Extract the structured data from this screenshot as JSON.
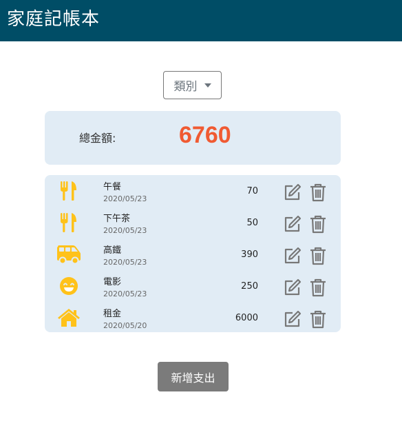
{
  "app": {
    "title": "家庭記帳本"
  },
  "filter": {
    "category_label": "類別"
  },
  "summary": {
    "total_label": "總金額:",
    "total_value": "6760"
  },
  "colors": {
    "header": "#004d66",
    "accent_icon": "#ffc21a",
    "total": "#f05a32",
    "card": "#e1ecf5"
  },
  "expenses": [
    {
      "icon": "utensils-icon",
      "name": "午餐",
      "date": "2020/05/23",
      "amount": "70"
    },
    {
      "icon": "utensils-icon",
      "name": "下午茶",
      "date": "2020/05/23",
      "amount": "50"
    },
    {
      "icon": "shuttle-van-icon",
      "name": "高鐵",
      "date": "2020/05/23",
      "amount": "390"
    },
    {
      "icon": "grin-icon",
      "name": "電影",
      "date": "2020/05/23",
      "amount": "250"
    },
    {
      "icon": "home-icon",
      "name": "租金",
      "date": "2020/05/20",
      "amount": "6000"
    }
  ],
  "actions": {
    "add_label": "新增支出"
  }
}
